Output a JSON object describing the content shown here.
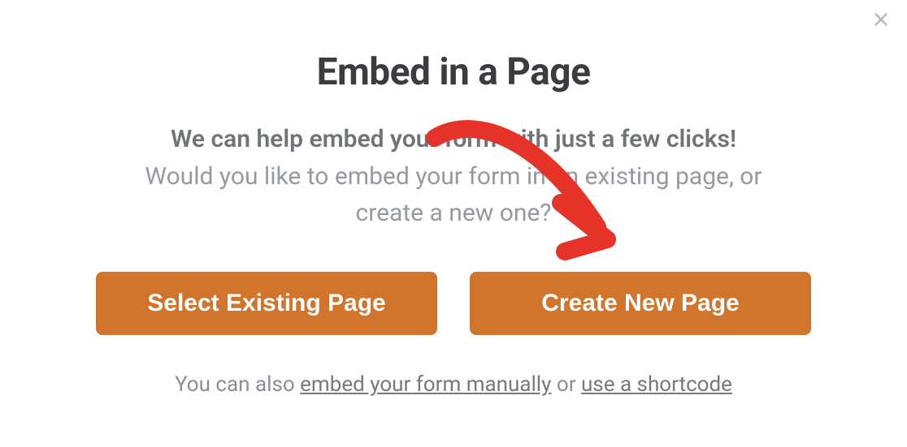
{
  "modal": {
    "title": "Embed in a Page",
    "subtitle_bold": "We can help embed your form with just a few clicks!",
    "subtitle_line1": "Would you like to embed your form in an existing page, or",
    "subtitle_line2": "create a new one?",
    "buttons": {
      "select_existing": "Select Existing Page",
      "create_new": "Create New Page"
    },
    "footer": {
      "prefix": "You can also ",
      "link1": "embed your form manually",
      "middle": " or ",
      "link2": "use a shortcode"
    }
  }
}
